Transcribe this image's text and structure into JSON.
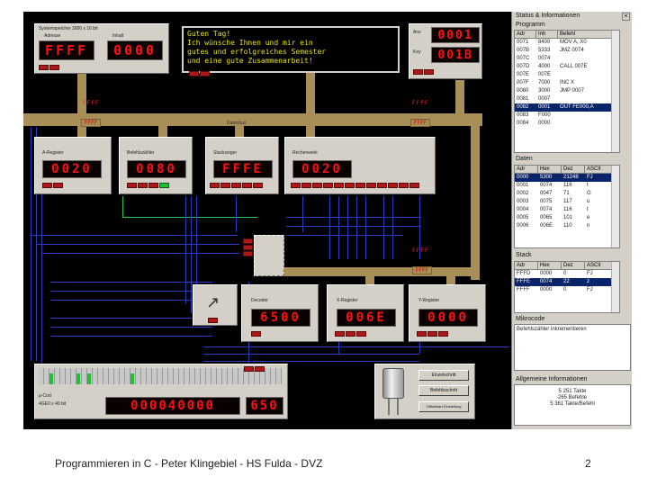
{
  "message": {
    "lines": [
      "Guten Tag!",
      "Ich wünsche Ihnen und mir ein",
      "gutes und erfolgreiches Semester",
      "und eine gute Zusammenarbeit!"
    ]
  },
  "system_memory": {
    "title": "Systemspeicher 3000 x 16 bit",
    "addr_label": "Adresse",
    "content_label": "Inhalt",
    "addr": "FFFF",
    "content": "0000"
  },
  "addr_in": {
    "label": "Anz",
    "value": "0001"
  },
  "key_in": {
    "label": "Key",
    "value": "001B"
  },
  "bus": {
    "label": "Datenbus",
    "ffff": "FFFF"
  },
  "registers": {
    "a": {
      "label": "A-Register",
      "value": "0020"
    },
    "pc": {
      "label": "Befehlszähler",
      "value": "0080"
    },
    "sp": {
      "label": "Stackzeiger",
      "value": "FFFE"
    },
    "alu": {
      "label": "Rechenwerk",
      "value": "0020"
    },
    "decoder": {
      "label": "Decoder",
      "value": "6500"
    },
    "x": {
      "label": "X-Register",
      "value": "006E"
    },
    "y": {
      "label": "Y-Register",
      "value": "0000"
    }
  },
  "cpu": {
    "label": "μ-Cod",
    "sublabel": "4GE0 x 40 bit",
    "value": "000040000",
    "value2": "650"
  },
  "sim_buttons": [
    "Einzelschritt",
    "Befehlsschritt",
    "Offsetstart Einstellung"
  ],
  "right_panel": {
    "title": "Status & Informationen",
    "program": {
      "label": "Programm",
      "columns": [
        "Adr",
        "Inh",
        "Befehl"
      ],
      "rows": [
        {
          "cells": [
            "0071",
            "8400",
            "MOV  A, X0"
          ],
          "selected": false
        },
        {
          "cells": [
            "007B",
            "5333",
            "JMZ  0074"
          ],
          "selected": false
        },
        {
          "cells": [
            "007C",
            "0074",
            ""
          ],
          "selected": false
        },
        {
          "cells": [
            "007D",
            "4000",
            "CALL  007E"
          ],
          "selected": false
        },
        {
          "cells": [
            "007E",
            "007E",
            ""
          ],
          "selected": false
        },
        {
          "cells": [
            "007F",
            "7000",
            "INC  X"
          ],
          "selected": false
        },
        {
          "cells": [
            "0080",
            "3000",
            "JMP  0007"
          ],
          "selected": false
        },
        {
          "cells": [
            "0081",
            "0007",
            ""
          ],
          "selected": false
        },
        {
          "cells": [
            "0082",
            "0001",
            "OUT  FE000,A"
          ],
          "selected": true
        },
        {
          "cells": [
            "0083",
            "F000",
            ""
          ],
          "selected": false
        },
        {
          "cells": [
            "0084",
            "0000",
            ""
          ],
          "selected": false
        }
      ]
    },
    "data": {
      "label": "Daten",
      "columns": [
        "Adr",
        "Hex",
        "Dez",
        "ASCII"
      ],
      "rows": [
        {
          "cells": [
            "0000",
            "5300",
            "21248",
            "FJ"
          ],
          "selected": true
        },
        {
          "cells": [
            "0001",
            "0074",
            "116",
            "t"
          ],
          "selected": false
        },
        {
          "cells": [
            "0002",
            "0047",
            "71",
            "G"
          ],
          "selected": false
        },
        {
          "cells": [
            "0003",
            "0075",
            "117",
            "u"
          ],
          "selected": false
        },
        {
          "cells": [
            "0004",
            "0074",
            "116",
            "t"
          ],
          "selected": false
        },
        {
          "cells": [
            "0005",
            "0065",
            "101",
            "e"
          ],
          "selected": false
        },
        {
          "cells": [
            "0006",
            "006E",
            "110",
            "n"
          ],
          "selected": false
        }
      ]
    },
    "stack": {
      "label": "Stack",
      "columns": [
        "Adr",
        "Hex",
        "Dez",
        "ASCII"
      ],
      "rows": [
        {
          "cells": [
            "FFFD",
            "0000",
            "0",
            "FJ"
          ],
          "selected": false
        },
        {
          "cells": [
            "FFFE",
            "0074",
            "22",
            "z"
          ],
          "selected": true
        },
        {
          "cells": [
            "FFFF",
            "0000",
            "0",
            "FJ"
          ],
          "selected": false
        }
      ]
    },
    "microcode": {
      "label": "Mikrocode",
      "text": "Befehlszähler inkrementieren"
    },
    "general": {
      "label": "Allgemeine Informationen",
      "lines": [
        "5 251 Takte",
        "265 Befehle",
        "5 361 Takte/Befehl"
      ]
    }
  },
  "footer": "Programmieren in C - Peter Klingebiel - HS Fulda - DVZ",
  "page_number": "2"
}
